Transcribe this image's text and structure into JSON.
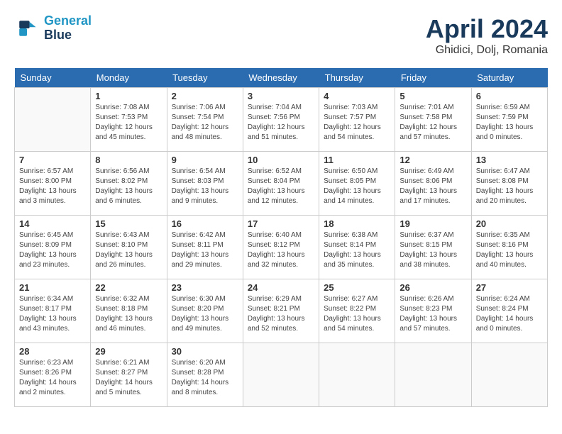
{
  "header": {
    "logo_line1": "General",
    "logo_line2": "Blue",
    "month": "April 2024",
    "location": "Ghidici, Dolj, Romania"
  },
  "days_of_week": [
    "Sunday",
    "Monday",
    "Tuesday",
    "Wednesday",
    "Thursday",
    "Friday",
    "Saturday"
  ],
  "weeks": [
    [
      null,
      {
        "day": 1,
        "sunrise": "7:08 AM",
        "sunset": "7:53 PM",
        "daylight": "12 hours and 45 minutes."
      },
      {
        "day": 2,
        "sunrise": "7:06 AM",
        "sunset": "7:54 PM",
        "daylight": "12 hours and 48 minutes."
      },
      {
        "day": 3,
        "sunrise": "7:04 AM",
        "sunset": "7:56 PM",
        "daylight": "12 hours and 51 minutes."
      },
      {
        "day": 4,
        "sunrise": "7:03 AM",
        "sunset": "7:57 PM",
        "daylight": "12 hours and 54 minutes."
      },
      {
        "day": 5,
        "sunrise": "7:01 AM",
        "sunset": "7:58 PM",
        "daylight": "12 hours and 57 minutes."
      },
      {
        "day": 6,
        "sunrise": "6:59 AM",
        "sunset": "7:59 PM",
        "daylight": "13 hours and 0 minutes."
      }
    ],
    [
      {
        "day": 7,
        "sunrise": "6:57 AM",
        "sunset": "8:00 PM",
        "daylight": "13 hours and 3 minutes."
      },
      {
        "day": 8,
        "sunrise": "6:56 AM",
        "sunset": "8:02 PM",
        "daylight": "13 hours and 6 minutes."
      },
      {
        "day": 9,
        "sunrise": "6:54 AM",
        "sunset": "8:03 PM",
        "daylight": "13 hours and 9 minutes."
      },
      {
        "day": 10,
        "sunrise": "6:52 AM",
        "sunset": "8:04 PM",
        "daylight": "13 hours and 12 minutes."
      },
      {
        "day": 11,
        "sunrise": "6:50 AM",
        "sunset": "8:05 PM",
        "daylight": "13 hours and 14 minutes."
      },
      {
        "day": 12,
        "sunrise": "6:49 AM",
        "sunset": "8:06 PM",
        "daylight": "13 hours and 17 minutes."
      },
      {
        "day": 13,
        "sunrise": "6:47 AM",
        "sunset": "8:08 PM",
        "daylight": "13 hours and 20 minutes."
      }
    ],
    [
      {
        "day": 14,
        "sunrise": "6:45 AM",
        "sunset": "8:09 PM",
        "daylight": "13 hours and 23 minutes."
      },
      {
        "day": 15,
        "sunrise": "6:43 AM",
        "sunset": "8:10 PM",
        "daylight": "13 hours and 26 minutes."
      },
      {
        "day": 16,
        "sunrise": "6:42 AM",
        "sunset": "8:11 PM",
        "daylight": "13 hours and 29 minutes."
      },
      {
        "day": 17,
        "sunrise": "6:40 AM",
        "sunset": "8:12 PM",
        "daylight": "13 hours and 32 minutes."
      },
      {
        "day": 18,
        "sunrise": "6:38 AM",
        "sunset": "8:14 PM",
        "daylight": "13 hours and 35 minutes."
      },
      {
        "day": 19,
        "sunrise": "6:37 AM",
        "sunset": "8:15 PM",
        "daylight": "13 hours and 38 minutes."
      },
      {
        "day": 20,
        "sunrise": "6:35 AM",
        "sunset": "8:16 PM",
        "daylight": "13 hours and 40 minutes."
      }
    ],
    [
      {
        "day": 21,
        "sunrise": "6:34 AM",
        "sunset": "8:17 PM",
        "daylight": "13 hours and 43 minutes."
      },
      {
        "day": 22,
        "sunrise": "6:32 AM",
        "sunset": "8:18 PM",
        "daylight": "13 hours and 46 minutes."
      },
      {
        "day": 23,
        "sunrise": "6:30 AM",
        "sunset": "8:20 PM",
        "daylight": "13 hours and 49 minutes."
      },
      {
        "day": 24,
        "sunrise": "6:29 AM",
        "sunset": "8:21 PM",
        "daylight": "13 hours and 52 minutes."
      },
      {
        "day": 25,
        "sunrise": "6:27 AM",
        "sunset": "8:22 PM",
        "daylight": "13 hours and 54 minutes."
      },
      {
        "day": 26,
        "sunrise": "6:26 AM",
        "sunset": "8:23 PM",
        "daylight": "13 hours and 57 minutes."
      },
      {
        "day": 27,
        "sunrise": "6:24 AM",
        "sunset": "8:24 PM",
        "daylight": "14 hours and 0 minutes."
      }
    ],
    [
      {
        "day": 28,
        "sunrise": "6:23 AM",
        "sunset": "8:26 PM",
        "daylight": "14 hours and 2 minutes."
      },
      {
        "day": 29,
        "sunrise": "6:21 AM",
        "sunset": "8:27 PM",
        "daylight": "14 hours and 5 minutes."
      },
      {
        "day": 30,
        "sunrise": "6:20 AM",
        "sunset": "8:28 PM",
        "daylight": "14 hours and 8 minutes."
      },
      null,
      null,
      null,
      null
    ]
  ]
}
